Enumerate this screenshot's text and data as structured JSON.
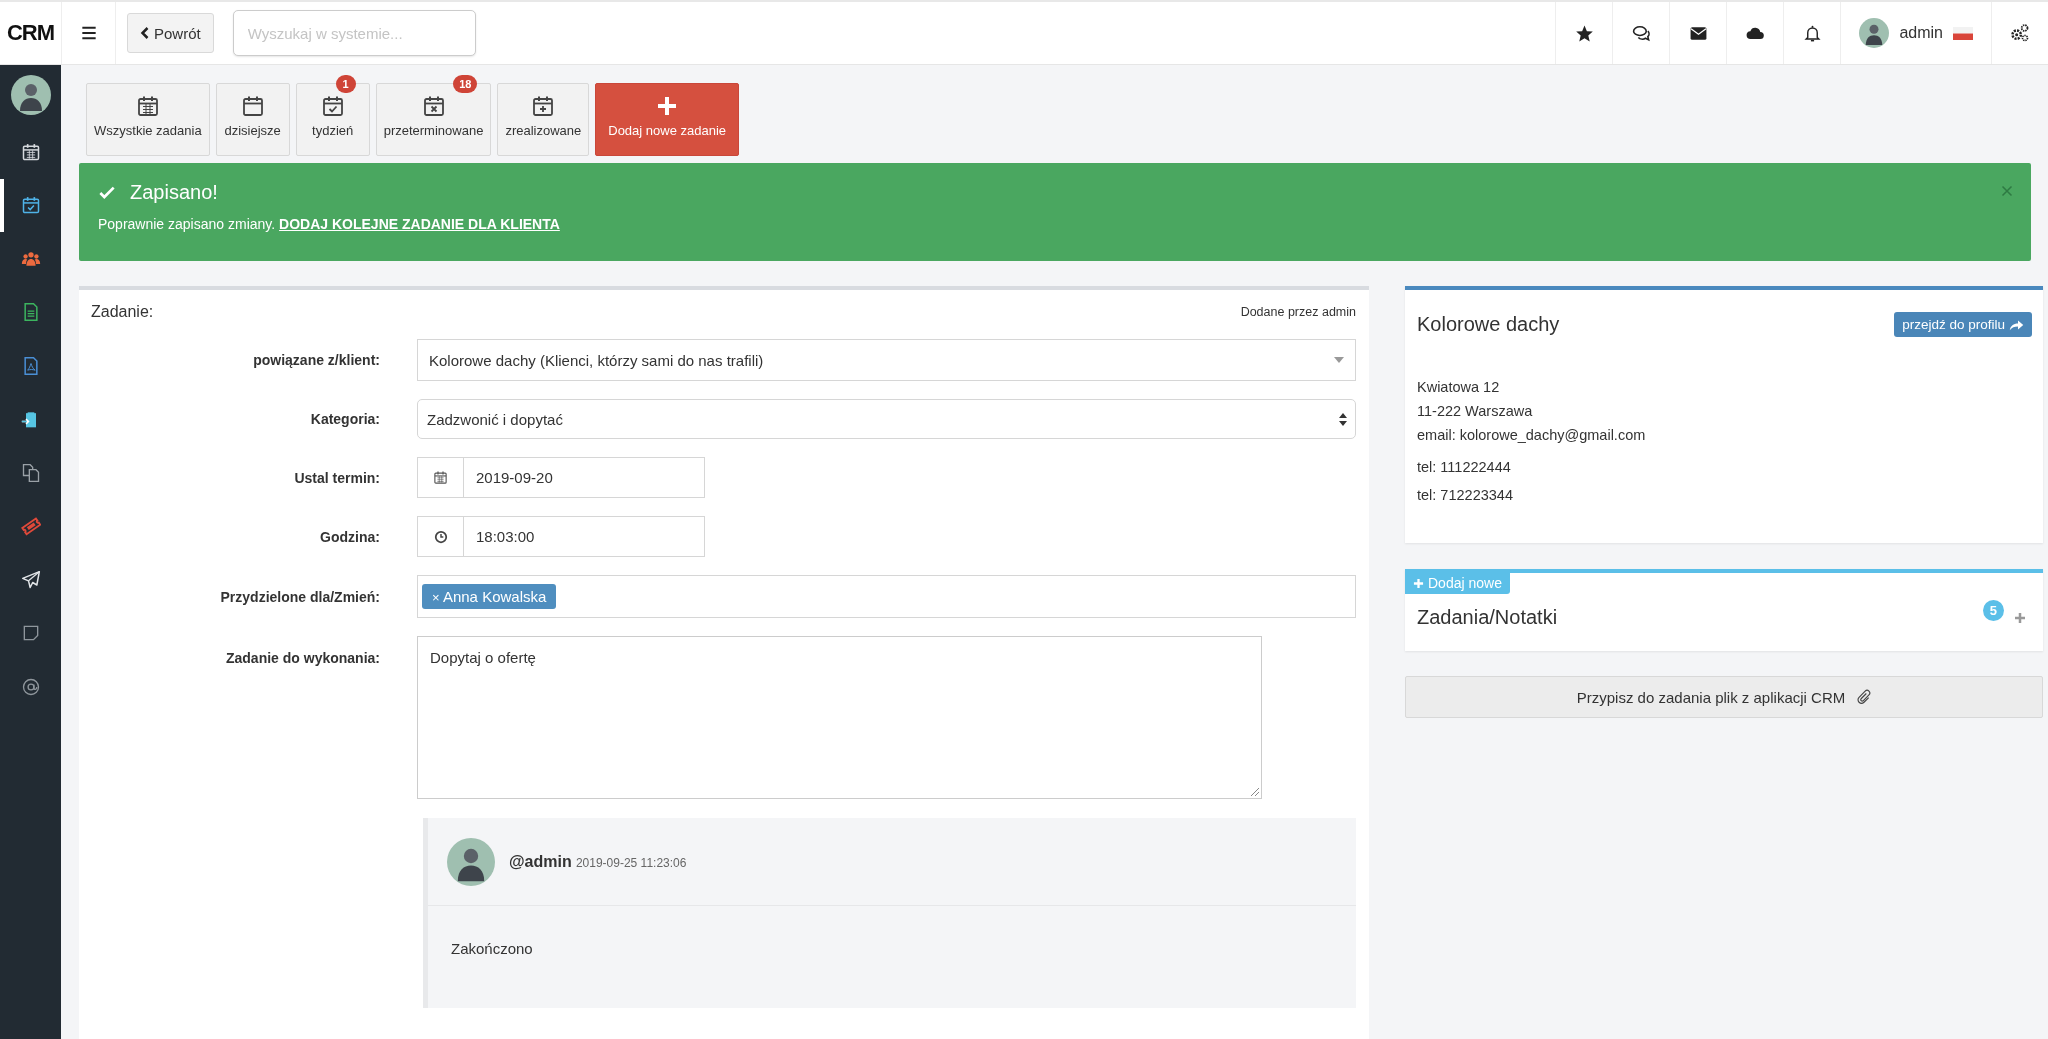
{
  "brand": "CRM",
  "top_bar": {
    "back_button": "Powrót",
    "search": {
      "placeholder": "Wyszukaj w systemie..."
    },
    "user": "admin"
  },
  "sidebar": {
    "items": [
      {
        "kind": "calendar",
        "color": "#d5d9dd",
        "selected": false
      },
      {
        "kind": "calendar-check",
        "color": "#4fb3e8",
        "selected": true
      },
      {
        "kind": "users",
        "color": "#ec6a3f",
        "selected": false
      },
      {
        "kind": "file",
        "color": "#3cb55f",
        "selected": false
      },
      {
        "kind": "pdf",
        "color": "#4a8fd6",
        "selected": false
      },
      {
        "kind": "clipboard",
        "color": "#56c5e3",
        "selected": false
      },
      {
        "kind": "copy",
        "color": "#9aa1a7",
        "selected": false
      },
      {
        "kind": "ticket",
        "color": "#e0493a",
        "selected": false
      },
      {
        "kind": "plane",
        "color": "#e2e5e8",
        "selected": false
      },
      {
        "kind": "note",
        "color": "#8f969c",
        "selected": false
      },
      {
        "kind": "at",
        "color": "#8f969c",
        "selected": false
      }
    ]
  },
  "quick_actions": [
    {
      "kind": "calendar",
      "label": "Wszystkie zadania"
    },
    {
      "kind": "calendar",
      "label": "dzisiejsze"
    },
    {
      "kind": "calendar-check",
      "label": "tydzień",
      "badge": "1"
    },
    {
      "kind": "calendar-x",
      "label": "przeterminowane",
      "badge": "18"
    },
    {
      "kind": "calendar-plus",
      "label": "zrealizowane"
    },
    {
      "kind": "add",
      "label": "Dodaj nowe zadanie"
    }
  ],
  "alert": {
    "title": "Zapisano!",
    "text": "Poprawnie zapisano zmiany.",
    "link": "DODAJ KOLEJNE ZADANIE DLA KLIENTA"
  },
  "task_form": {
    "title": "Zadanie:",
    "added_by": "Dodane przez admin",
    "fields": [
      {
        "kind": "select",
        "label": "powiązane z/klient:",
        "value": "Kolorowe dachy (Klienci, którzy sami do nas trafili)"
      },
      {
        "kind": "spinner",
        "label": "Kategoria:",
        "value": "Zadzwonić i dopytać"
      },
      {
        "kind": "date",
        "label": "Ustal termin:",
        "value": "2019-09-20"
      },
      {
        "kind": "time",
        "label": "Godzina:",
        "value": "18:03:00"
      },
      {
        "kind": "tags",
        "label": "Przydzielone dla/Zmień:",
        "remove_mark": "×",
        "tags": [
          "Anna Kowalska"
        ]
      },
      {
        "kind": "textarea",
        "label": "Zadanie do wykonania:",
        "value": "Dopytaj o ofertę"
      }
    ]
  },
  "comment": {
    "author": "@admin",
    "time": "2019-09-25 11:23:06",
    "text": "Zakończono"
  },
  "client_card": {
    "name": "Kolorowe dachy",
    "profile_button": "przejdź do profilu",
    "address": [
      "Kwiatowa 12",
      "11-222 Warszawa",
      "email: kolorowe_dachy@gmail.com"
    ],
    "phones": [
      "tel: 111222444",
      "tel: 712223344"
    ]
  },
  "notes_card": {
    "add_label": "Dodaj nowe",
    "title": "Zadania/Notatki",
    "count": "5"
  },
  "attach_button": "Przypisz do zadania plik z aplikacji CRM"
}
